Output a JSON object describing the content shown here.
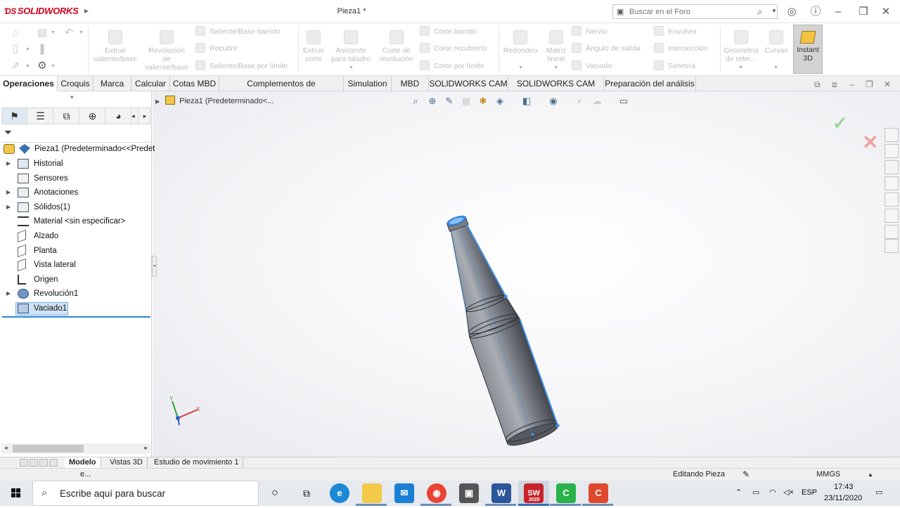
{
  "window": {
    "app_name": "SOLIDWORKS",
    "title": "Pieza1 *",
    "search_placeholder": "Buscar en el Foro"
  },
  "command_manager": {
    "buttons_left": [
      {
        "label": "Extruir saliente/base"
      },
      {
        "label": "Revolución de saliente/base"
      }
    ],
    "small_col1": [
      "Saliente/Base barrido",
      "Recubrir",
      "Saliente/Base por límite"
    ],
    "buttons_mid": [
      {
        "label": "Extruir corte"
      },
      {
        "label": "Asistente para taladro"
      },
      {
        "label": "Corte de revolución"
      }
    ],
    "small_col2": [
      "Corte barrido",
      "Corte recubierto",
      "Corte por límite"
    ],
    "buttons_right1": [
      {
        "label": "Redondeo"
      },
      {
        "label": "Matriz lineal"
      }
    ],
    "small_col3": [
      "Nervio",
      "Ángulo de salida",
      "Vaciado"
    ],
    "small_col4": [
      "Envolver",
      "Intersección",
      "Simetría"
    ],
    "buttons_right2": [
      {
        "label": "Geometría de refer..."
      },
      {
        "label": "Curvas"
      }
    ],
    "instant3d": "Instant 3D"
  },
  "tabs": [
    "Operaciones",
    "Croquis",
    "Marca",
    "Calcular",
    "Cotas MBD",
    "Complementos de SOLIDWORKS",
    "Simulation",
    "MBD",
    "SOLIDWORKS CAM",
    "SOLIDWORKS CAM TBM",
    "Preparación del análisis"
  ],
  "feature_tree": {
    "root": "Pieza1  (Predeterminado<<Predet",
    "items": [
      {
        "label": "Historial",
        "expandable": true
      },
      {
        "label": "Sensores",
        "expandable": false
      },
      {
        "label": "Anotaciones",
        "expandable": true
      },
      {
        "label": "Sólidos(1)",
        "expandable": true
      },
      {
        "label": "Material <sin especificar>",
        "expandable": false
      },
      {
        "label": "Alzado",
        "expandable": false
      },
      {
        "label": "Planta",
        "expandable": false
      },
      {
        "label": "Vista lateral",
        "expandable": false
      },
      {
        "label": "Origen",
        "expandable": false
      },
      {
        "label": "Revolución1",
        "expandable": true
      },
      {
        "label": "Vaciado1",
        "expandable": false
      }
    ]
  },
  "viewport": {
    "breadcrumb": "Pieza1  (Predeterminado<...",
    "axis_x": "X",
    "axis_y": "Y"
  },
  "bottom_tabs": [
    "Modelo",
    "Vistas 3D",
    "Estudio de movimiento 1"
  ],
  "status_bar": {
    "left": "e...",
    "mode": "Editando Pieza",
    "units": "MMGS"
  },
  "taskbar": {
    "search_placeholder": "Escribe aquí para buscar",
    "sw_badge": "2020",
    "lang": "ESP",
    "time": "17:43",
    "date": "23/11/2020"
  },
  "colors": {
    "accent": "#2f84d6",
    "brand": "#d0021b",
    "bottle": "#6d7179",
    "edge_highlight": "#3d8fe6"
  }
}
